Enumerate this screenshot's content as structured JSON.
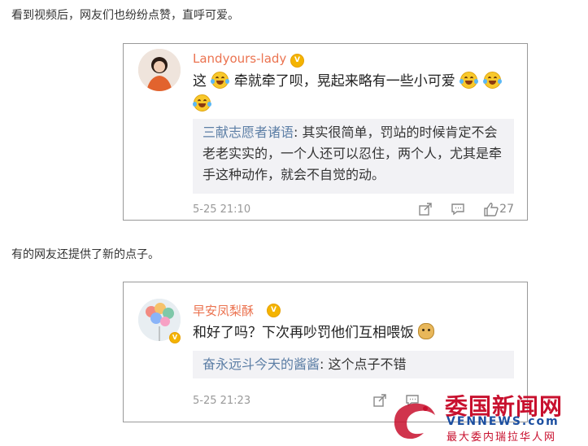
{
  "intro_text": "看到视频后，网友们也纷纷点赞，直呼可爱。",
  "second_text": "有的网友还提供了新的点子。",
  "comments": [
    {
      "username": "Landyours-lady",
      "avatar_icon": "user-avatar",
      "badge_icon": "vip-crown-icon",
      "text_parts": [
        "这",
        "牵就牵了呗，晃起来略有一些小可爱"
      ],
      "emoji_icon": "laugh-cry-emoji-icon",
      "reply_name": "三献志愿者诸语",
      "reply_text": ": 其实很简单，罚站的时候肯定不会老老实实的，一个人还可以忍住，两个人，尤其是牵手这种动作，就会不自觉的动。",
      "timestamp": "5-25 21:10",
      "like_count": "27"
    },
    {
      "username": "早安凤梨酥",
      "avatar_icon": "balloons-avatar",
      "badge_icon": "vip-crown-icon",
      "text": "和好了吗？下次再吵罚他们互相喂饭",
      "emoji_icon": "doge-emoji-icon",
      "reply_name": "奋永远斗今天的酱酱",
      "reply_text": ": 这个点子不错",
      "timestamp": "5-25 21:23"
    }
  ],
  "watermark": {
    "title": "委国新闻网",
    "url": "VENNEWS.com",
    "subtitle": "最大委内瑞拉华人网"
  },
  "colors": {
    "username": "#eb7350",
    "reply_name": "#5d7fa6",
    "reply_bg": "#f2f2f5",
    "watermark_red": "#c8102e",
    "watermark_blue": "#1c4fa0"
  }
}
